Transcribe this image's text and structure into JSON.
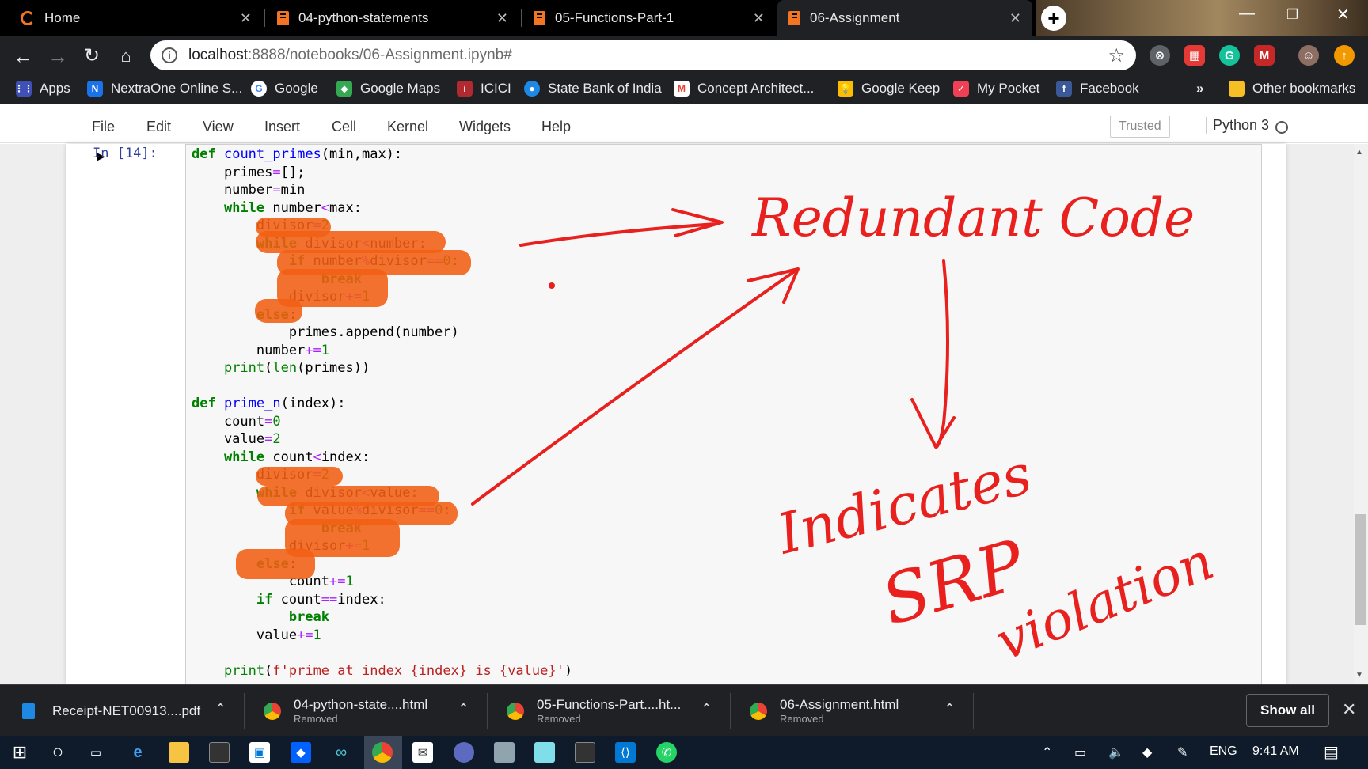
{
  "browser": {
    "tabs": [
      {
        "label": "Home",
        "icon": "jupyter-icon",
        "active": false
      },
      {
        "label": "04-python-statements",
        "icon": "notebook-icon",
        "active": false
      },
      {
        "label": "05-Functions-Part-1",
        "icon": "notebook-icon",
        "active": false
      },
      {
        "label": "06-Assignment",
        "icon": "notebook-icon",
        "active": true
      }
    ],
    "url_host": "localhost",
    "url_path": ":8888/notebooks/06-Assignment.ipynb#",
    "bookmarks": [
      {
        "label": "Apps",
        "icon": "apps-grid-icon",
        "color": "#ea4335"
      },
      {
        "label": "NextraOne Online S...",
        "icon": "nextraone-icon",
        "color": "#1a73e8"
      },
      {
        "label": "Google",
        "icon": "google-icon",
        "color": "#4285f4"
      },
      {
        "label": "Google Maps",
        "icon": "maps-icon",
        "color": "#34a853"
      },
      {
        "label": "ICICI",
        "icon": "icici-icon",
        "color": "#b02a30"
      },
      {
        "label": "State Bank of India",
        "icon": "sbi-icon",
        "color": "#1e88e5"
      },
      {
        "label": "Concept Architect...",
        "icon": "gmail-icon",
        "color": "#ea4335"
      },
      {
        "label": "Google Keep",
        "icon": "keep-icon",
        "color": "#fbbc04"
      },
      {
        "label": "My Pocket",
        "icon": "pocket-icon",
        "color": "#ef4056"
      },
      {
        "label": "Facebook",
        "icon": "facebook-icon",
        "color": "#3b5998"
      }
    ],
    "bookmarks_overflow": "»",
    "other_bookmarks": "Other bookmarks"
  },
  "jupyter": {
    "menu": [
      "File",
      "Edit",
      "View",
      "Insert",
      "Cell",
      "Kernel",
      "Widgets",
      "Help"
    ],
    "trusted": "Trusted",
    "kernel": "Python 3",
    "prompt": "In [14]:"
  },
  "annotations": {
    "redundant": "Redundant Code",
    "indicates": "Indicates",
    "srp": "SRP",
    "violation": "violation"
  },
  "downloads": [
    {
      "name": "Receipt-NET00913....pdf",
      "status": "",
      "icon": "pdf-icon"
    },
    {
      "name": "04-python-state....html",
      "status": "Removed",
      "icon": "chrome-icon"
    },
    {
      "name": "05-Functions-Part....ht...",
      "status": "Removed",
      "icon": "chrome-icon"
    },
    {
      "name": "06-Assignment.html",
      "status": "Removed",
      "icon": "chrome-icon"
    }
  ],
  "downloads_show_all": "Show all",
  "taskbar": {
    "language": "ENG",
    "time": "9:41 AM"
  },
  "colors": {
    "highlight": "#f15f12",
    "annotation": "#e8201e",
    "keyword": "#008000",
    "string": "#ba2121"
  }
}
